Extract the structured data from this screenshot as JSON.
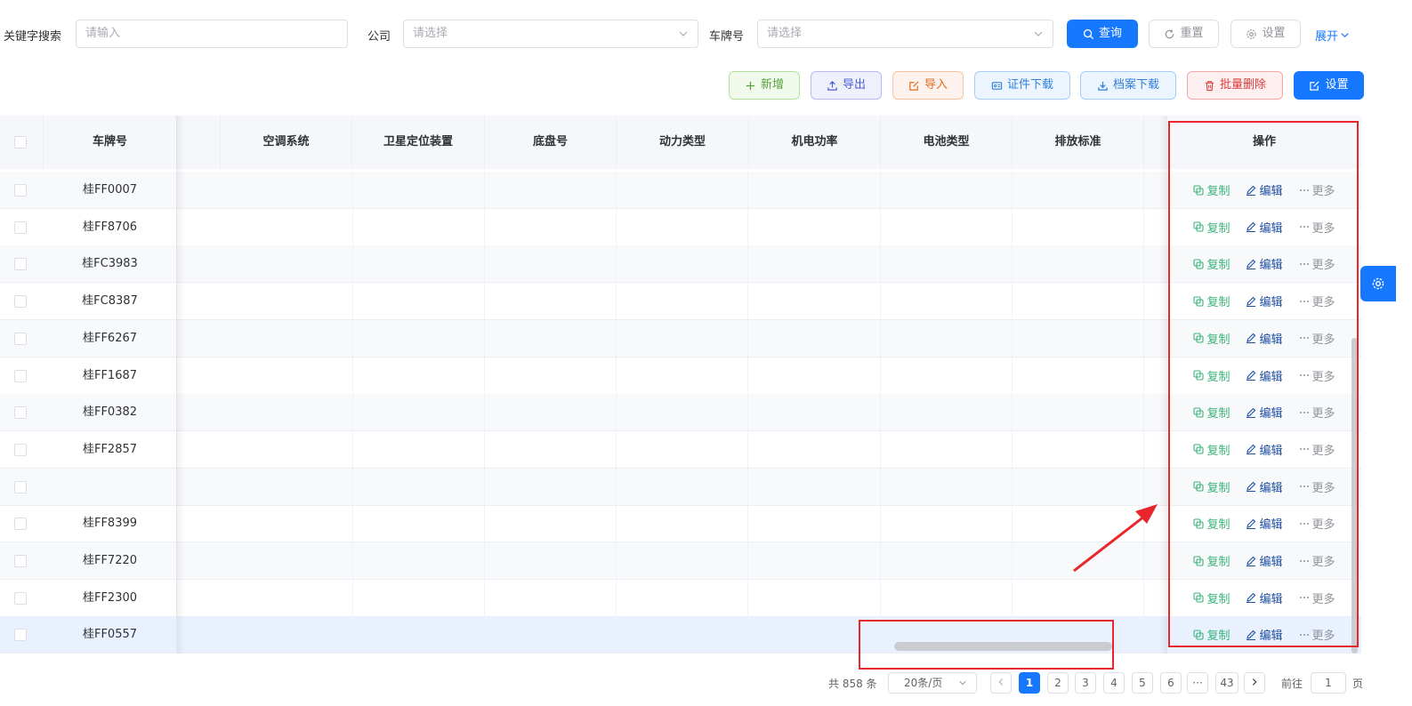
{
  "filters": {
    "keyword_label": "关键字搜索",
    "keyword_placeholder": "请输入",
    "company_label": "公司",
    "company_placeholder": "请选择",
    "plate_label": "车牌号",
    "plate_placeholder": "请选择",
    "query_button": "查询",
    "reset_button": "重置",
    "settings_button": "设置",
    "expand_link": "展开"
  },
  "toolbar": {
    "add": "新增",
    "export": "导出",
    "import": "导入",
    "cert_download": "证件下载",
    "archive_download": "档案下载",
    "batch_delete": "批量删除",
    "settings": "设置"
  },
  "table": {
    "columns": {
      "plate": "车牌号",
      "ac": "空调系统",
      "gps": "卫星定位装置",
      "chassis": "底盘号",
      "power": "动力类型",
      "motor": "机电功率",
      "battery": "电池类型",
      "emission": "排放标准",
      "ops": "操作"
    },
    "row_actions": {
      "copy": "复制",
      "edit": "编辑",
      "more": "更多"
    },
    "rows": [
      {
        "plate": "桂FF0007"
      },
      {
        "plate": "桂FF8706"
      },
      {
        "plate": "桂FC3983"
      },
      {
        "plate": "桂FC8387"
      },
      {
        "plate": "桂FF6267"
      },
      {
        "plate": "桂FF1687"
      },
      {
        "plate": "桂FF0382"
      },
      {
        "plate": "桂FF2857"
      },
      {
        "plate": ""
      },
      {
        "plate": "桂FF8399"
      },
      {
        "plate": "桂FF7220"
      },
      {
        "plate": "桂FF2300"
      },
      {
        "plate": "桂FF0557"
      }
    ]
  },
  "pagination": {
    "total": "共 858 条",
    "page_size": "20条/页",
    "pages": [
      "1",
      "2",
      "3",
      "4",
      "5",
      "6",
      "···",
      "43"
    ],
    "current_page": "1",
    "jump_prefix": "前往",
    "jump_value": "1",
    "jump_suffix": "页"
  },
  "colors": {
    "primary": "#1677ff",
    "copy": "#3bb37a",
    "edit": "#1f4fa3",
    "annotation": "#e8262b"
  }
}
